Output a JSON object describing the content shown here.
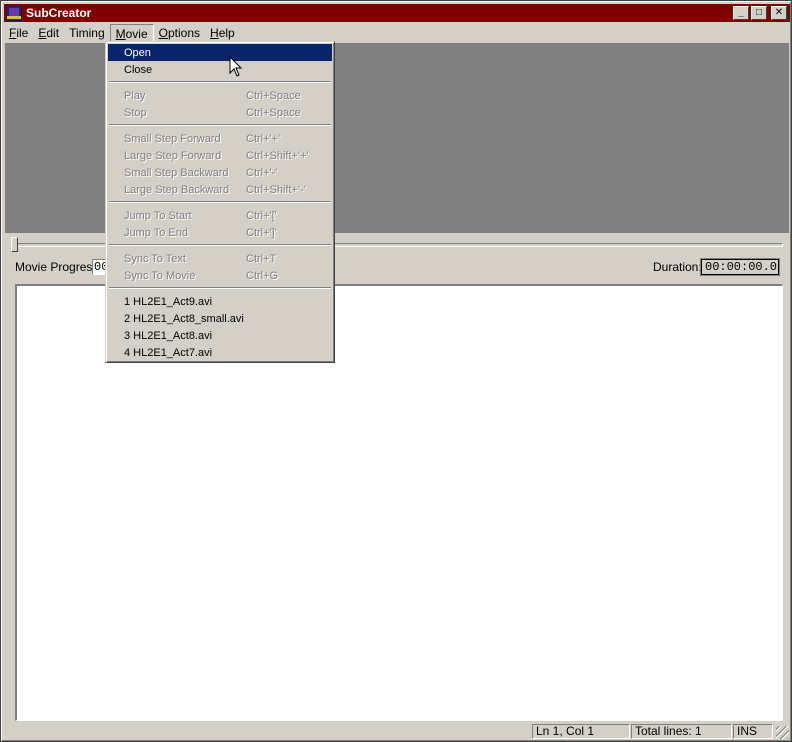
{
  "window": {
    "title": "SubCreator"
  },
  "titlebar_buttons": {
    "minimize": "_",
    "maximize": "□",
    "close": "✕"
  },
  "menubar": {
    "items": [
      {
        "label": "File",
        "mnemonic_index": 0
      },
      {
        "label": "Edit",
        "mnemonic_index": 0
      },
      {
        "label": "Timing",
        "mnemonic_index": -1
      },
      {
        "label": "Movie",
        "mnemonic_index": 0,
        "active": true
      },
      {
        "label": "Options",
        "mnemonic_index": 0
      },
      {
        "label": "Help",
        "mnemonic_index": 0
      }
    ]
  },
  "movie_menu": {
    "groups": [
      [
        {
          "label": "Open",
          "shortcut": "",
          "state": "highlighted"
        },
        {
          "label": "Close",
          "shortcut": "",
          "state": "enabled"
        }
      ],
      [
        {
          "label": "Play",
          "shortcut": "Ctrl+Space",
          "state": "disabled"
        },
        {
          "label": "Stop",
          "shortcut": "Ctrl+Space",
          "state": "disabled"
        }
      ],
      [
        {
          "label": "Small Step Forward",
          "shortcut": "Ctrl+'+'",
          "state": "disabled"
        },
        {
          "label": "Large Step Forward",
          "shortcut": "Ctrl+Shift+'+'",
          "state": "disabled"
        },
        {
          "label": "Small Step Backward",
          "shortcut": "Ctrl+'-'",
          "state": "disabled"
        },
        {
          "label": "Large Step Backward",
          "shortcut": "Ctrl+Shift+'-'",
          "state": "disabled"
        }
      ],
      [
        {
          "label": "Jump To Start",
          "shortcut": "Ctrl+'['",
          "state": "disabled"
        },
        {
          "label": "Jump To End",
          "shortcut": "Ctrl+']'",
          "state": "disabled"
        }
      ],
      [
        {
          "label": "Sync To Text",
          "shortcut": "Ctrl+T",
          "state": "disabled"
        },
        {
          "label": "Sync To Movie",
          "shortcut": "Ctrl+G",
          "state": "disabled"
        }
      ],
      [
        {
          "label": "1 HL2E1_Act9.avi",
          "shortcut": "",
          "state": "enabled"
        },
        {
          "label": "2 HL2E1_Act8_small.avi",
          "shortcut": "",
          "state": "enabled"
        },
        {
          "label": "3 HL2E1_Act8.avi",
          "shortcut": "",
          "state": "enabled"
        },
        {
          "label": "4 HL2E1_Act7.avi",
          "shortcut": "",
          "state": "enabled"
        }
      ]
    ]
  },
  "movie_progress": {
    "label": "Movie Progress:",
    "value": "00"
  },
  "duration": {
    "label": "Duration:",
    "value": "00:00:00.0"
  },
  "editor": {
    "text": ""
  },
  "statusbar": {
    "position": "Ln 1, Col 1",
    "total_lines": "Total lines: 1",
    "mode": "INS"
  },
  "colors": {
    "titlebar": "#800000",
    "menu_highlight": "#0a246a",
    "video_bg": "#808080",
    "face": "#d4d0c8"
  }
}
